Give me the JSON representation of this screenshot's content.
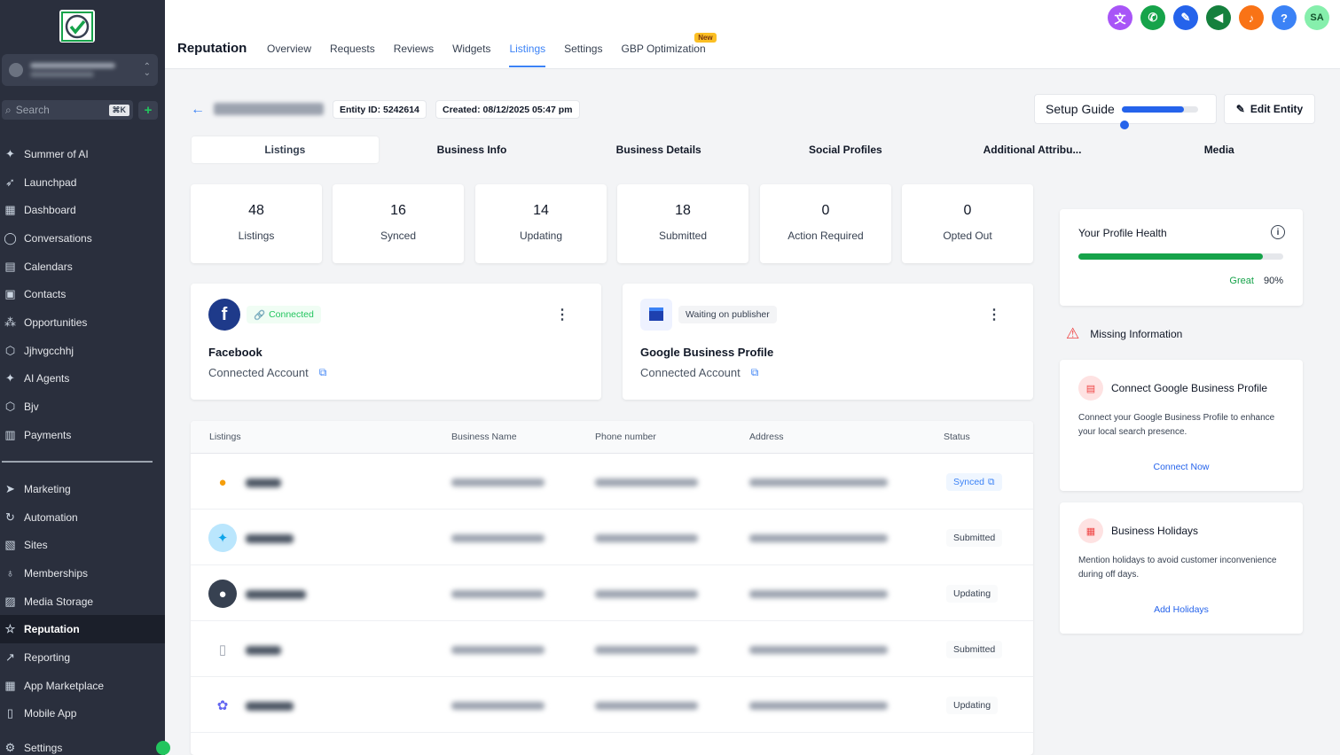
{
  "sidebar": {
    "search_placeholder": "Search",
    "search_shortcut": "⌘K",
    "items_top": [
      {
        "label": "Summer of AI",
        "icon": "sparkle-icon"
      },
      {
        "label": "Launchpad",
        "icon": "rocket-icon"
      },
      {
        "label": "Dashboard",
        "icon": "grid-icon"
      },
      {
        "label": "Conversations",
        "icon": "chat-icon"
      },
      {
        "label": "Calendars",
        "icon": "calendar-icon"
      },
      {
        "label": "Contacts",
        "icon": "contacts-icon"
      },
      {
        "label": "Opportunities",
        "icon": "network-icon"
      },
      {
        "label": "Jjhvgcchhj",
        "icon": "box-icon"
      },
      {
        "label": "AI Agents",
        "icon": "sparkle-icon"
      },
      {
        "label": "Bjv",
        "icon": "box-icon"
      },
      {
        "label": "Payments",
        "icon": "receipt-icon"
      }
    ],
    "items_bottom": [
      {
        "label": "Marketing",
        "icon": "send-icon"
      },
      {
        "label": "Automation",
        "icon": "automation-icon"
      },
      {
        "label": "Sites",
        "icon": "sites-icon"
      },
      {
        "label": "Memberships",
        "icon": "memberships-icon"
      },
      {
        "label": "Media Storage",
        "icon": "image-icon"
      },
      {
        "label": "Reputation",
        "icon": "star-icon",
        "active": true
      },
      {
        "label": "Reporting",
        "icon": "chart-icon"
      },
      {
        "label": "App Marketplace",
        "icon": "apps-icon"
      },
      {
        "label": "Mobile App",
        "icon": "mobile-icon"
      }
    ],
    "settings_label": "Settings"
  },
  "topbar": {
    "title": "Reputation",
    "tabs": [
      "Overview",
      "Requests",
      "Reviews",
      "Widgets",
      "Listings",
      "Settings",
      "GBP Optimization"
    ],
    "active_tab": "Listings",
    "new_badge": "New",
    "icon_colors": [
      "#a855f7",
      "#16a34a",
      "#2563eb",
      "#15803d",
      "#f97316",
      "#3b82f6",
      "#86efac"
    ],
    "user_initials": "SA"
  },
  "entity": {
    "entity_id": "Entity ID: 5242614",
    "created": "Created: 08/12/2025 05:47 pm",
    "setup_guide": "Setup Guide",
    "setup_progress": 0.82,
    "edit_label": "Edit Entity"
  },
  "subtabs": [
    "Listings",
    "Business Info",
    "Business Details",
    "Social Profiles",
    "Additional Attribu...",
    "Media"
  ],
  "stats": [
    {
      "value": "48",
      "label": "Listings"
    },
    {
      "value": "16",
      "label": "Synced"
    },
    {
      "value": "14",
      "label": "Updating"
    },
    {
      "value": "18",
      "label": "Submitted"
    },
    {
      "value": "0",
      "label": "Action Required"
    },
    {
      "value": "0",
      "label": "Opted Out"
    }
  ],
  "accounts": [
    {
      "status": "Connected",
      "name": "Facebook",
      "sub": "Connected Account"
    },
    {
      "status": "Waiting on publisher",
      "name": "Google Business Profile",
      "sub": "Connected Account"
    }
  ],
  "table": {
    "headers": [
      "Listings",
      "Business Name",
      "Phone number",
      "Address",
      "Status"
    ],
    "rows": [
      {
        "status": "Synced"
      },
      {
        "status": "Submitted"
      },
      {
        "status": "Updating"
      },
      {
        "status": "Submitted"
      },
      {
        "status": "Updating"
      }
    ]
  },
  "health": {
    "title": "Your Profile Health",
    "rating": "Great",
    "percent": "90%",
    "value": 0.9
  },
  "missing_title": "Missing Information",
  "tips": [
    {
      "title": "Connect Google Business Profile",
      "desc": "Connect your Google Business Profile to enhance your local search presence.",
      "action": "Connect Now"
    },
    {
      "title": "Business Holidays",
      "desc": "Mention holidays to avoid customer inconvenience during off days.",
      "action": "Add Holidays"
    }
  ]
}
